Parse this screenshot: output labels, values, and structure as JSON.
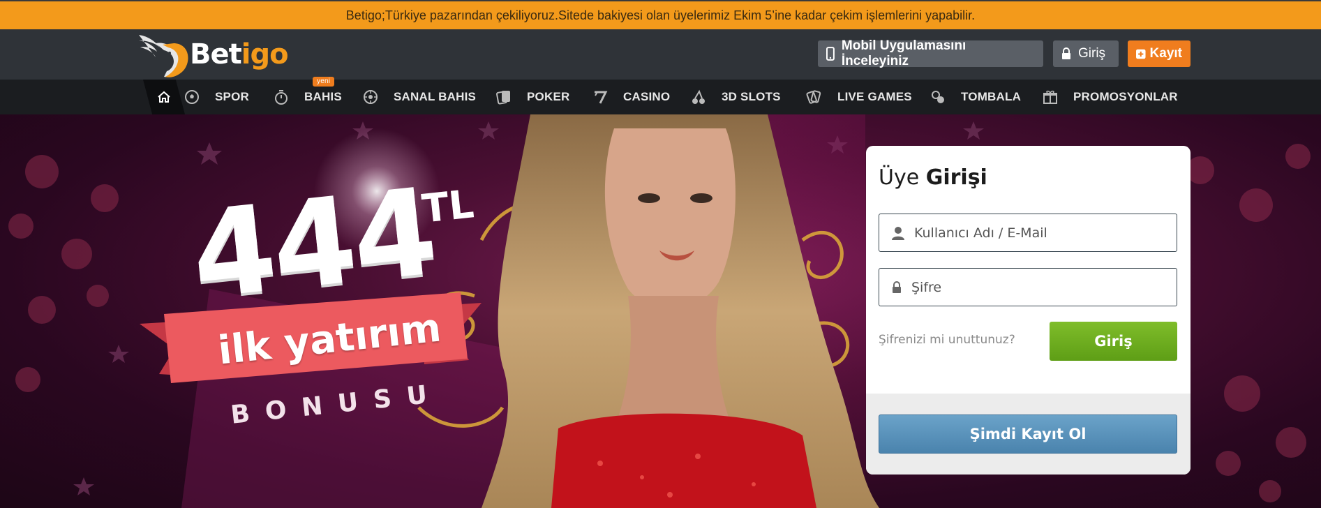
{
  "announcement": {
    "text": "Betigo;Türkiye pazarından çekiliyoruz.Sitede bakiyesi olan üyelerimiz Ekim 5’ine kadar çekim işlemlerini yapabilir."
  },
  "header": {
    "logo": {
      "part1": "Bet",
      "part2": "igo"
    },
    "mobile_button": "Mobil Uygulamasını İnceleyiniz",
    "login_button": "Giriş",
    "register_button": "Kayıt"
  },
  "nav": {
    "items": [
      {
        "label": "SPOR",
        "icon": "soccer-ball-icon"
      },
      {
        "label": "BAHIS",
        "icon": "stopwatch-icon",
        "badge": "yeni"
      },
      {
        "label": "SANAL BAHIS",
        "icon": "virtual-wheel-icon"
      },
      {
        "label": "POKER",
        "icon": "cards-icon"
      },
      {
        "label": "CASINO",
        "icon": "seven-icon"
      },
      {
        "label": "3D SLOTS",
        "icon": "cherries-icon"
      },
      {
        "label": "LIVE GAMES",
        "icon": "live-cards-icon"
      },
      {
        "label": "TOMBALA",
        "icon": "bingo-balls-icon"
      },
      {
        "label": "PROMOSYONLAR",
        "icon": "gift-icon"
      }
    ]
  },
  "hero": {
    "amount": "444",
    "currency": "TL",
    "ribbon_text": "ilk yatırım",
    "subtitle": "BONUSU"
  },
  "login_card": {
    "title_light": "Üye",
    "title_bold": "Girişi",
    "username_placeholder": "Kullanıcı Adı / E-Mail",
    "password_placeholder": "Şifre",
    "forgot_link": "Şifrenizi mi unuttunuz?",
    "submit_button": "Giriş",
    "register_button": "Şimdi Kayıt Ol"
  },
  "colors": {
    "accent_orange": "#f39a1b",
    "header_bg": "#2f3338",
    "nav_bg": "#1b1d20",
    "green_button": "#6aab1f",
    "blue_button": "#5a93bb"
  }
}
